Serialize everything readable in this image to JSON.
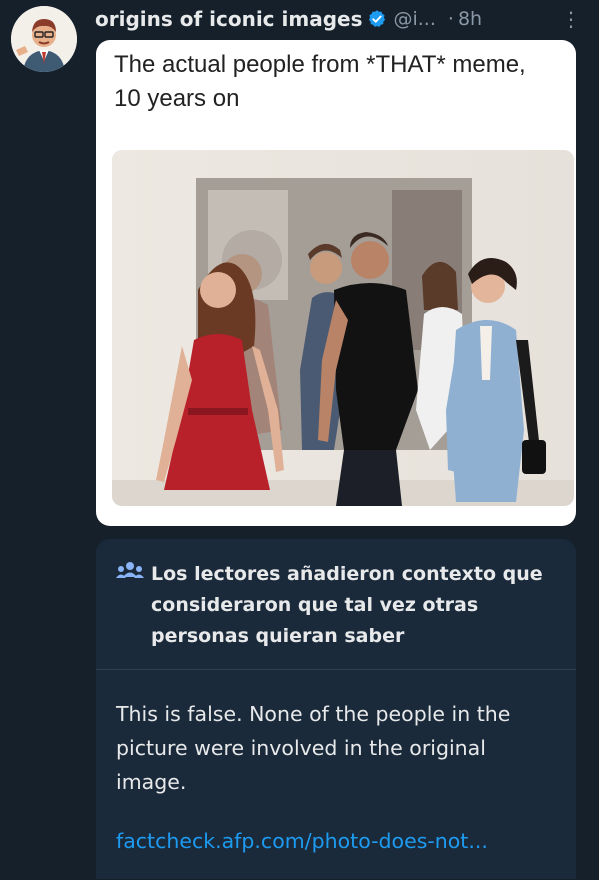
{
  "tweet": {
    "author": "origins of iconic images",
    "handle": "@i...",
    "separator": "·",
    "time": "8h",
    "more": "⋮",
    "text": "The actual people from *THAT* meme, 10 years on"
  },
  "community_note": {
    "title": "Los lectores añadieron contexto que consideraron que tal vez otras personas quieran saber",
    "body": "This is false. None of the people in the picture were involved in the original image.",
    "link": "factcheck.afp.com/photo-does-not..."
  },
  "colors": {
    "background": "#15202b",
    "note_background": "#1b2a3a",
    "link": "#1d9bf0",
    "verified": "#1d9bf0",
    "secondary_text": "#8b98a5"
  },
  "icons": [
    "avatar",
    "verified-badge-icon",
    "more-options-icon",
    "community-notes-people-icon"
  ]
}
